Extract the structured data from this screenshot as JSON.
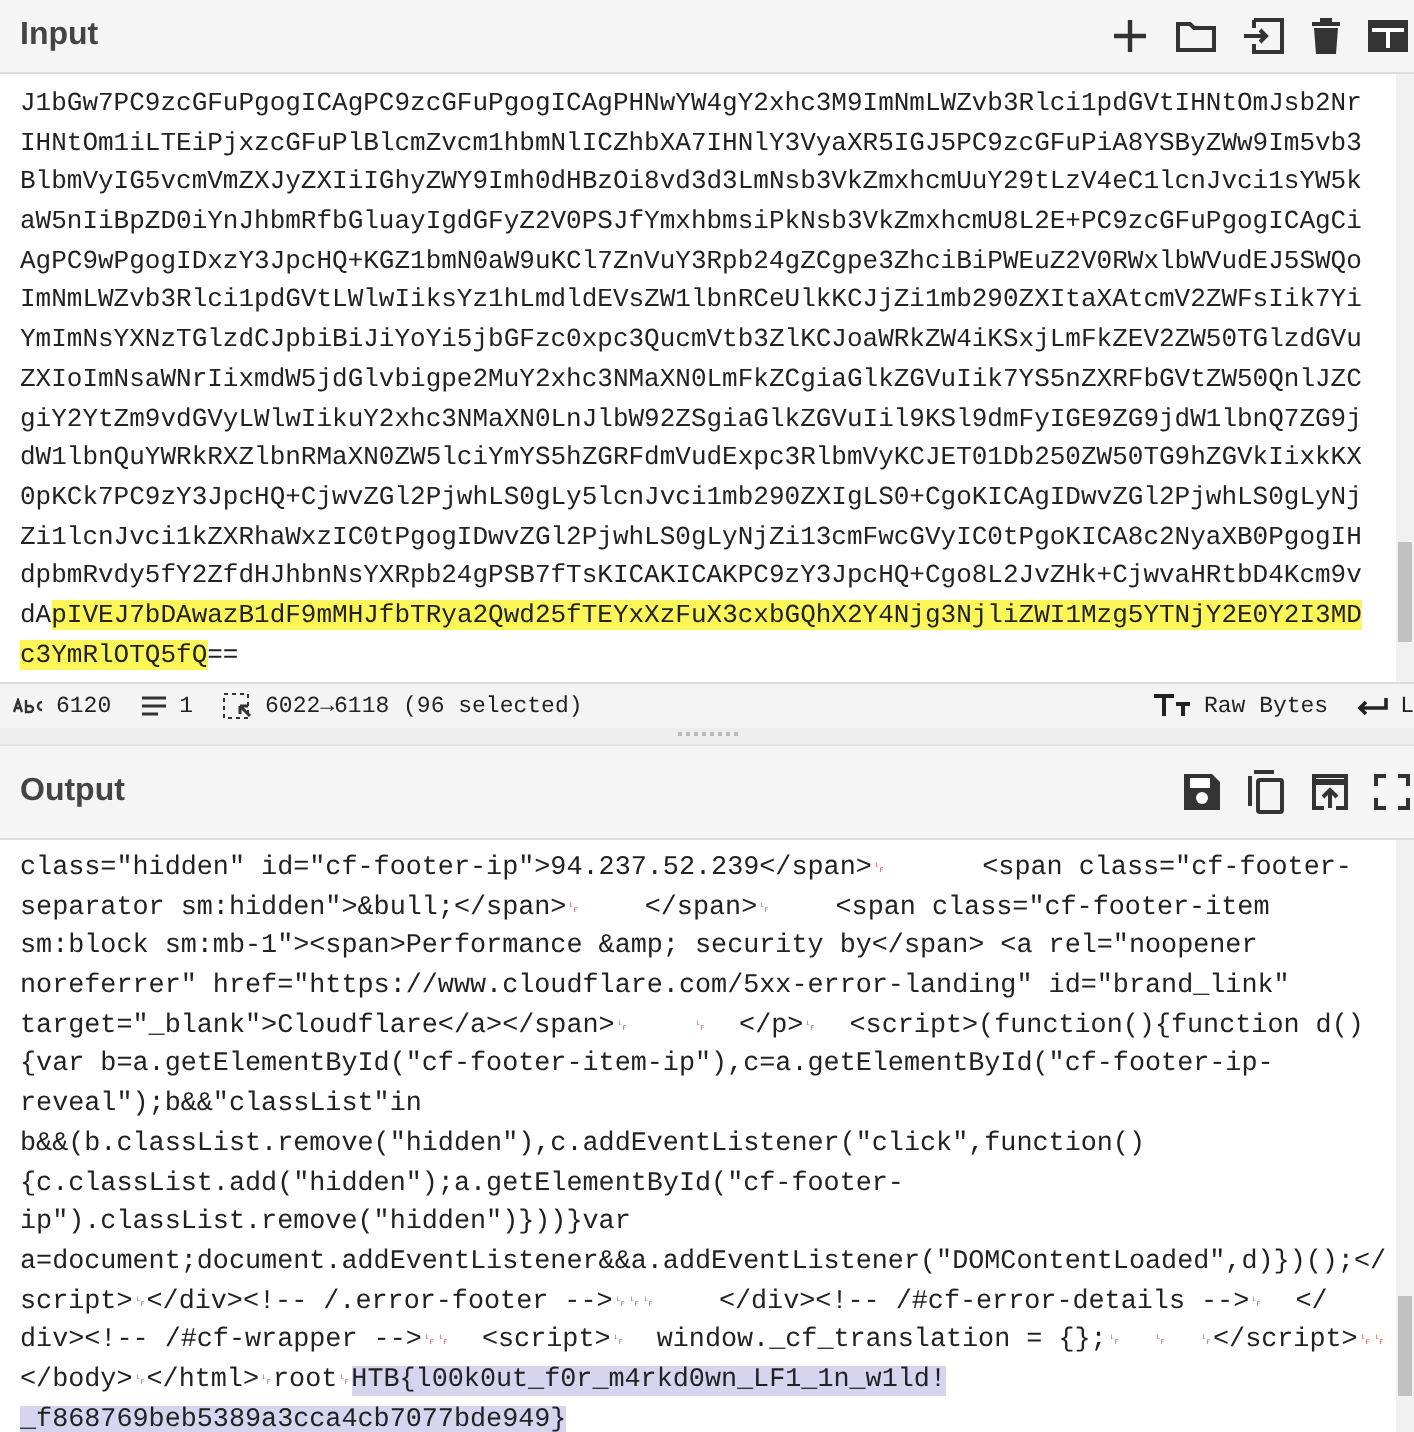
{
  "input": {
    "title": "Input",
    "lines": [
      {
        "segments": [
          {
            "text": "J1bGw7PC9zcGFuPgogICAgPC9zcGFuPgogICAgPHNwYW4gY2xhc3M9ImNmLWZvb3Rlci1pdGVtIHNtOmJsb2Nr",
            "highlighted": false
          }
        ]
      },
      {
        "segments": [
          {
            "text": "IHNtOm1iLTEiPjxzcGFuPlBlcmZvcm1hbmNlICZhbXA7IHNlY3VyaXR5IGJ5PC9zcGFuPiA8YSByZWw9Im5vb3",
            "highlighted": false
          }
        ]
      },
      {
        "segments": [
          {
            "text": "BlbmVyIG5vcmVmZXJyZXIiIGhyZWY9Imh0dHBzOi8vd3d3LmNsb3VkZmxhcmUuY29tLzV4eC1lcnJvci1sYW5k",
            "highlighted": false
          }
        ]
      },
      {
        "segments": [
          {
            "text": "aW5nIiBpZD0iYnJhbmRfbGluayIgdGFyZ2V0PSJfYmxhbmsiPkNsb3VkZmxhcmU8L2E+PC9zcGFuPgogICAgCi",
            "highlighted": false
          }
        ]
      },
      {
        "segments": [
          {
            "text": "AgPC9wPgogIDxzY3JpcHQ+KGZ1bmN0aW9uKCl7ZnVuY3Rpb24gZCgpe3ZhciBiPWEuZ2V0RWxlbWVudEJ5SWQo",
            "highlighted": false
          }
        ]
      },
      {
        "segments": [
          {
            "text": "ImNmLWZvb3Rlci1pdGVtLWlwIiksYz1hLmdldEVsZW1lbnRCeUlkKCJjZi1mb290ZXItaXAtcmV2ZWFsIik7Yi",
            "highlighted": false
          }
        ]
      },
      {
        "segments": [
          {
            "text": "YmImNsYXNzTGlzdCJpbiBiJiYoYi5jbGFzc0xpc3QucmVtb3ZlKCJoaWRkZW4iKSxjLmFkZEV2ZW50TGlzdGVu",
            "highlighted": false
          }
        ]
      },
      {
        "segments": [
          {
            "text": "ZXIoImNsaWNrIixmdW5jdGlvbigpe2MuY2xhc3NMaXN0LmFkZCgiaGlkZGVuIik7YS5nZXRFbGVtZW50QnlJZC",
            "highlighted": false
          }
        ]
      },
      {
        "segments": [
          {
            "text": "giY2YtZm9vdGVyLWlwIikuY2xhc3NMaXN0LnJlbW92ZSgiaGlkZGVuIil9KSl9dmFyIGE9ZG9jdW1lbnQ7ZG9j",
            "highlighted": false
          }
        ]
      },
      {
        "segments": [
          {
            "text": "dW1lbnQuYWRkRXZlbnRMaXN0ZW5lciYmYS5hZGRFdmVudExpc3RlbmVyKCJET01Db250ZW50TG9hZGVkIixkKX",
            "highlighted": false
          }
        ]
      },
      {
        "segments": [
          {
            "text": "0pKCk7PC9zY3JpcHQ+CjwvZGl2PjwhLS0gLy5lcnJvci1mb290ZXIgLS0+CgoKICAgIDwvZGl2PjwhLS0gLyNj",
            "highlighted": false
          }
        ]
      },
      {
        "segments": [
          {
            "text": "Zi1lcnJvci1kZXRhaWxzIC0tPgogIDwvZGl2PjwhLS0gLyNjZi13cmFwcGVyIC0tPgoKICA8c2NyaXB0PgogIH",
            "highlighted": false
          }
        ]
      },
      {
        "segments": [
          {
            "text": "dpbmRvdy5fY2ZfdHJhbnNsYXRpb24gPSB7fTsKICAKICAKPC9zY3JpcHQ+Cgo8L2JvZHk+CjwvaHRtbD4Kcm9v",
            "highlighted": false
          }
        ]
      },
      {
        "segments": [
          {
            "text": "dA",
            "highlighted": false
          },
          {
            "text": "pIVEJ7bDAwazB1dF9mMHJfbTRya2Qwd25fTEYxXzFuX3cxbGQhX2Y4Njg3NjliZWI1Mzg5YTNjY2E0Y2I3MD",
            "highlighted": true
          }
        ]
      },
      {
        "segments": [
          {
            "text": "c3YmRlOTQ5fQ",
            "highlighted": true
          },
          {
            "text": "==",
            "highlighted": false
          }
        ]
      }
    ],
    "status_bar": {
      "characters": "6120",
      "lines": "1",
      "selection": "6022→6118 (96 selected)",
      "encoding": "Raw Bytes",
      "line_ending": "L"
    }
  },
  "output": {
    "title": "Output",
    "lines": [
      {
        "segments": [
          {
            "text": "class=\"hidden\" id=\"cf-footer-ip\">94.237.52.239</span>␊      <span class=\"cf-footer-",
            "highlighted": false
          }
        ]
      },
      {
        "segments": [
          {
            "text": "separator sm:hidden\">&bull;</span>␊    </span>␊    <span class=\"cf-footer-item",
            "highlighted": false
          }
        ]
      },
      {
        "segments": [
          {
            "text": "sm:block sm:mb-1\"><span>Performance &amp; security by</span> <a rel=\"noopener",
            "highlighted": false
          }
        ]
      },
      {
        "segments": [
          {
            "text": "noreferrer\" href=\"https://www.cloudflare.com/5xx-error-landing\" id=\"brand_link\"",
            "highlighted": false
          }
        ]
      },
      {
        "segments": [
          {
            "text": "target=\"_blank\">Cloudflare</a></span>␊    ␊  </p>␊  <script>(function(){function d()",
            "highlighted": false
          }
        ]
      },
      {
        "segments": [
          {
            "text": "{var b=a.getElementById(\"cf-footer-item-ip\"),c=a.getElementById(\"cf-footer-ip-",
            "highlighted": false
          }
        ]
      },
      {
        "segments": [
          {
            "text": "reveal\");b&&\"classList\"in",
            "highlighted": false
          }
        ]
      },
      {
        "segments": [
          {
            "text": "b&&(b.classList.remove(\"hidden\"),c.addEventListener(\"click\",function()",
            "highlighted": false
          }
        ]
      },
      {
        "segments": [
          {
            "text": "{c.classList.add(\"hidden\");a.getElementById(\"cf-footer-",
            "highlighted": false
          }
        ]
      },
      {
        "segments": [
          {
            "text": "ip\").classList.remove(\"hidden\")}))}var",
            "highlighted": false
          }
        ]
      },
      {
        "segments": [
          {
            "text": "a=document;document.addEventListener&&a.addEventListener(\"DOMContentLoaded\",d)})();</",
            "highlighted": false
          }
        ]
      },
      {
        "segments": [
          {
            "text": "script>␊</div><!-- /.error-footer -->␊␊␊    </div><!-- /#cf-error-details -->␊  </",
            "highlighted": false
          }
        ]
      },
      {
        "segments": [
          {
            "text": "div><!-- /#cf-wrapper -->␊␊  <script>␊  window._cf_translation = {};␊  ␊  ␊</script>␊␊",
            "highlighted": false
          }
        ]
      },
      {
        "segments": [
          {
            "text": "</body>␊</html>␊root␊",
            "highlighted": false
          },
          {
            "text": "HTB{l00k0ut_f0r_m4rkd0wn_LF1_1n_w1ld!",
            "highlighted": true
          }
        ]
      },
      {
        "segments": [
          {
            "text": "_f868769beb5389a3cca4cb7077bde949}",
            "highlighted": true
          }
        ]
      }
    ]
  }
}
